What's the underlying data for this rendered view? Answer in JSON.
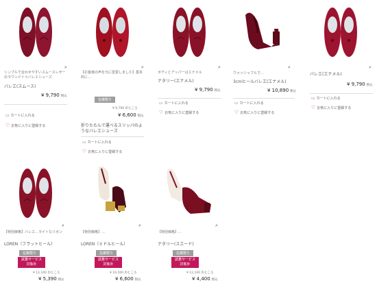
{
  "colors": {
    "accent": "#c2185b",
    "badge_grey": "#9e9e9e",
    "text": "#333333"
  },
  "common": {
    "zoom_icon": "magnifier-icon",
    "cart_label": "カートに入れる",
    "fav_label": "お気に入りに登録する",
    "tax_label": "税込"
  },
  "products": [
    {
      "desc": "シンプルで合わせやすいスムースレザーのラウンドトゥバレエシューズ",
      "name": "バレエ(スムース)",
      "price": "¥ 9,790"
    },
    {
      "desc": "【お客様の声を元に変更しました】基本的に…",
      "badge": "在庫限り",
      "old_price": "¥ 9,790 のところ",
      "price": "¥ 6,600",
      "name": "折りたたんで運べるスリッパのようなバレエシューズ"
    },
    {
      "desc": "ボディとアッパーはエナメル",
      "name": "ナタリー(エナメル)",
      "price": "¥ 9,790"
    },
    {
      "desc": "ウォッシャブルで…",
      "name": "3cmヒールバレエ(エナメル)",
      "price": "¥ 10,890"
    },
    {
      "name": "バレエ(エナメル)",
      "price": "¥ 9,790"
    },
    {
      "desc": "【特別価格】バレエ…ライトなリボン",
      "name": "LOREN（フラットヒール）",
      "badge": "在庫限り",
      "badge2": "試着サービス対象外",
      "old_price": "¥ 12,100 のところ",
      "price": "¥ 5,390"
    },
    {
      "desc": "【特別価格】…",
      "name": "LOREN（ミドルヒール）",
      "badge": "在庫限り",
      "badge2": "試着サービス対象外",
      "old_price": "¥ 16,500 のところ",
      "price": "¥ 6,600"
    },
    {
      "desc": "【特別価格】…",
      "name": "ナタリー(スエード)",
      "badge": "在庫限り",
      "badge2": "試着サービス対象外",
      "old_price": "¥ 12,100 のところ",
      "price": "¥ 4,400"
    }
  ]
}
